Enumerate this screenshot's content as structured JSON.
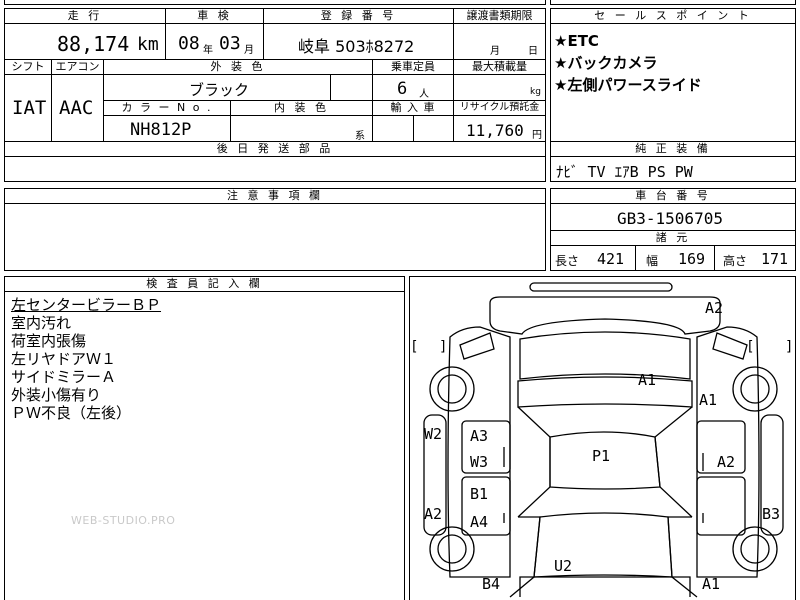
{
  "header": {
    "mileage_label": "走 行",
    "inspection_label": "車 検",
    "registration_label": "登 録 番 号",
    "transfer_deadline_label": "譲渡書類期限",
    "mileage_value": "88,174",
    "mileage_unit": "km",
    "inspection_year": "08",
    "year_unit": "年",
    "inspection_month": "03",
    "month_unit": "月",
    "registration_value": "岐阜 503ﾎ8272",
    "deadline_month_unit": "月",
    "deadline_day_unit": "日"
  },
  "row2": {
    "shift_label": "シフト",
    "aircon_label": "エアコン",
    "exterior_color_label": "外 装 色",
    "capacity_label": "乗車定員",
    "max_load_label": "最大積載量",
    "shift_value": "IAT",
    "aircon_value": "AAC",
    "exterior_color_value": "ブラック",
    "capacity_value": "6",
    "capacity_unit": "人",
    "max_load_unit": "kg",
    "color_no_label": "カ ラ ー N o .",
    "interior_color_label": "内 装 色",
    "import_label": "輸 入 車",
    "recycle_label": "リサイクル預託金",
    "color_no_value": "NH812P",
    "interior_unit": "系",
    "recycle_value": "11,760",
    "recycle_unit": "円"
  },
  "later_parts_label": "後 日 発 送 部 品",
  "sales_points": {
    "label": "セ ー ル ス ポ イ ン ト",
    "items": [
      "★ETC",
      "★バックカメラ",
      "★左側パワースライド"
    ]
  },
  "genuine_equipment": {
    "label": "純 正 装 備",
    "value": "ﾅﾋﾞ TV ｴｱB PS PW"
  },
  "caution_label": "注 意 事 項 欄",
  "chassis": {
    "label": "車 台 番 号",
    "value": "GB3-1506705",
    "specs_label": "諸 元",
    "length_label": "長さ",
    "length_value": "421",
    "width_label": "幅",
    "width_value": "169",
    "height_label": "高さ",
    "height_value": "171"
  },
  "inspector": {
    "label": "検 査 員 記 入 欄",
    "notes": [
      "左センタービラーＢＰ",
      "室内汚れ",
      "荷室内張傷",
      "左リヤドアＷ１",
      "サイドミラーＡ",
      "外装小傷有り",
      "ＰＷ不良（左後）"
    ]
  },
  "watermark": "WEB-STUDIO.PRO",
  "diagram": {
    "damage_marks": [
      "A2",
      "A1",
      "A1",
      "W2",
      "A3",
      "W3",
      "P1",
      "A2",
      "B1",
      "A4",
      "A2",
      "B3",
      "U2",
      "B4",
      "A1"
    ]
  }
}
